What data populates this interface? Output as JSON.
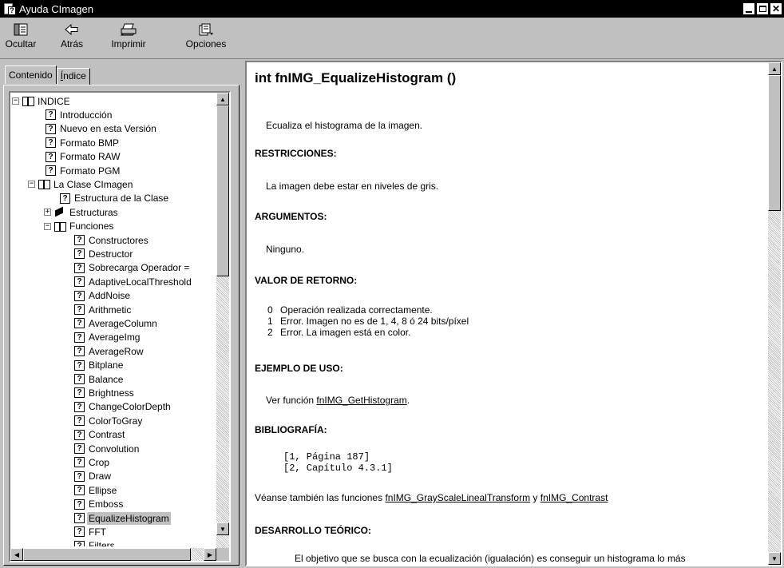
{
  "window": {
    "title": "Ayuda CImagen"
  },
  "toolbar": {
    "buttons": [
      {
        "label": "Ocultar",
        "icon": "hide-pane-icon"
      },
      {
        "label": "Atrás",
        "icon": "back-arrow-icon"
      },
      {
        "label": "Imprimir",
        "icon": "printer-icon"
      },
      {
        "label": "Opciones",
        "icon": "options-icon"
      }
    ]
  },
  "tabs": {
    "contents": "Contenido",
    "index_prefix": "Í",
    "index_rest": "ndice"
  },
  "tree": {
    "items": [
      "INDICE",
      "Introducción",
      "Nuevo en esta Versión",
      "Formato BMP",
      "Formato RAW",
      "Formato PGM",
      "La Clase CImagen",
      "Estructura de la Clase",
      "Estructuras",
      "Funciones",
      "Constructores",
      "Destructor",
      "Sobrecarga Operador =",
      "AdaptiveLocalThreshold",
      "AddNoise",
      "Arithmetic",
      "AverageColumn",
      "AverageImg",
      "AverageRow",
      "Bitplane",
      "Balance",
      "Brightness",
      "ChangeColorDepth",
      "ColorToGray",
      "Contrast",
      "Convolution",
      "Crop",
      "Draw",
      "Ellipse",
      "Emboss",
      "EqualizeHistogram",
      "FFT",
      "Filters"
    ],
    "selected": "EqualizeHistogram"
  },
  "doc": {
    "title": "int fnIMG_EqualizeHistogram ()",
    "description": "Ecualiza el histograma de la imagen.",
    "restrictions_heading": "RESTRICCIONES:",
    "restrictions_text": "La imagen debe estar en niveles de gris.",
    "arguments_heading": "ARGUMENTOS:",
    "arguments_text": "Ninguno.",
    "return_heading": "VALOR DE RETORNO:",
    "return_values": [
      {
        "code": "0",
        "text": "Operación realizada correctamente."
      },
      {
        "code": "1",
        "text": "Error. Imagen no es de 1, 4, 8 ó 24 bits/píxel"
      },
      {
        "code": "2",
        "text": "Error. La imagen está en color."
      }
    ],
    "example_heading": "EJEMPLO DE USO:",
    "example_prefix": "Ver función ",
    "example_link": "fnIMG_GetHistogram",
    "example_suffix": ".",
    "bibliography_heading": "BIBLIOGRAFÍA:",
    "bibliography_line1": "[1, Página 187]",
    "bibliography_line2": "[2, Capítulo 4.3.1]",
    "see_also_prefix": "Véanse también las funciones ",
    "see_also_link1": "fnIMG_GrayScaleLinealTransform",
    "see_also_mid": " y ",
    "see_also_link2": "fnIMG_Contrast",
    "theory_heading": "DESARROLLO TEÓRICO:",
    "theory_text": "El objetivo que se busca con la ecualización (igualación) es conseguir un histograma lo más"
  }
}
